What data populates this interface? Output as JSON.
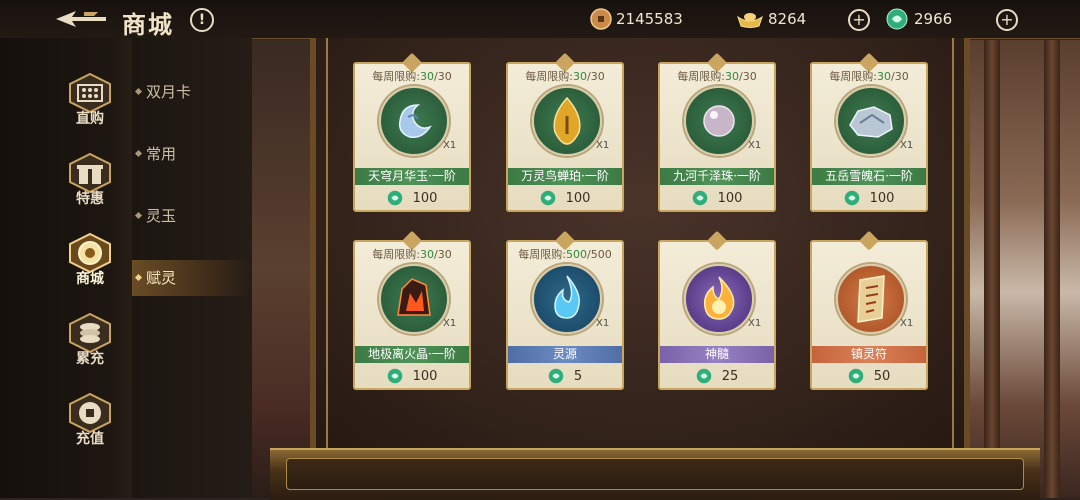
{
  "header": {
    "title": "商城",
    "info_icon": "exclamation-icon",
    "currencies": [
      {
        "icon": "copper-coin-icon",
        "amount": "2145583"
      },
      {
        "icon": "gold-ingot-icon",
        "amount": "8264"
      },
      {
        "icon": "jade-icon",
        "amount": "2966"
      }
    ]
  },
  "nav": {
    "items": [
      {
        "label": "直购",
        "icon": "abacus-icon"
      },
      {
        "label": "特惠",
        "icon": "gift-box-icon"
      },
      {
        "label": "商城",
        "icon": "shop-icon",
        "active": true
      },
      {
        "label": "累充",
        "icon": "coin-stack-icon"
      },
      {
        "label": "充值",
        "icon": "coin-icon"
      }
    ]
  },
  "subnav": {
    "items": [
      {
        "label": "双月卡"
      },
      {
        "label": "常用"
      },
      {
        "label": "灵玉"
      },
      {
        "label": "赋灵",
        "active": true
      }
    ]
  },
  "shop": {
    "limit_label": "每周限购:",
    "items": [
      {
        "name": "天穹月华玉·一阶",
        "limit_current": "30",
        "limit_total": "/30",
        "qty": "X1",
        "price": "100",
        "icon": "moon-jade-icon",
        "theme": "green"
      },
      {
        "name": "万灵鸟蝉珀·一阶",
        "limit_current": "30",
        "limit_total": "/30",
        "qty": "X1",
        "price": "100",
        "icon": "amber-icon",
        "theme": "green"
      },
      {
        "name": "九河千泽珠·一阶",
        "limit_current": "30",
        "limit_total": "/30",
        "qty": "X1",
        "price": "100",
        "icon": "pearl-icon",
        "theme": "green"
      },
      {
        "name": "五岳雪魄石·一阶",
        "limit_current": "30",
        "limit_total": "/30",
        "qty": "X1",
        "price": "100",
        "icon": "snow-stone-icon",
        "theme": "green"
      },
      {
        "name": "地极离火晶·一阶",
        "limit_current": "30",
        "limit_total": "/30",
        "qty": "X1",
        "price": "100",
        "icon": "fire-crystal-icon",
        "theme": "green"
      },
      {
        "name": "灵源",
        "limit_current": "500",
        "limit_total": "/500",
        "qty": "X1",
        "price": "5",
        "icon": "spirit-flame-icon",
        "theme": "blue"
      },
      {
        "name": "神髓",
        "limit_current": "",
        "limit_total": "",
        "qty": "X1",
        "price": "25",
        "icon": "fireball-icon",
        "theme": "purple"
      },
      {
        "name": "镇灵符",
        "limit_current": "",
        "limit_total": "",
        "qty": "X1",
        "price": "50",
        "icon": "talisman-icon",
        "theme": "orange"
      }
    ]
  },
  "colors": {
    "accent_gold": "#c9a560",
    "green_band": "#4f9257",
    "blue_band": "#6d8bc2",
    "purple_band": "#9781c2",
    "orange_band": "#db8058",
    "limit_green": "#2f8a3a"
  }
}
